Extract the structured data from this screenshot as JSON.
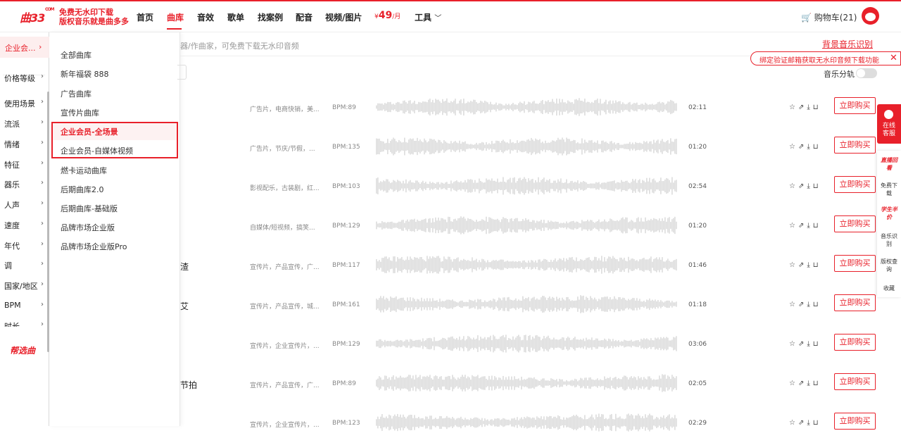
{
  "header": {
    "logo": "曲33",
    "logo_sup": "COM",
    "slogan_line1": "免费无水印下载",
    "slogan_line2": "版权音乐就是曲多多",
    "nav": [
      "首页",
      "曲库",
      "音效",
      "歌单",
      "找案例",
      "配音",
      "视频/图片"
    ],
    "active_nav": "曲库",
    "price_symbol": "¥",
    "price": "49",
    "price_unit": "/月",
    "tools": "工具",
    "cart": "购物车(21)"
  },
  "categories": {
    "first": "企业会...",
    "items": [
      "价格等级",
      "使用场景",
      "流派",
      "情绪",
      "特征",
      "器乐",
      "人声",
      "速度",
      "年代",
      "调",
      "国家/地区",
      "BPM",
      "时长"
    ],
    "help_select": "帮选曲"
  },
  "dropdown": {
    "items": [
      "全部曲库",
      "新年福袋 888",
      "广告曲库",
      "宣传片曲库",
      "企业会员-全场景",
      "企业会员-自媒体视频",
      "燃卡运动曲库",
      "后期曲库2.0",
      "后期曲库-基础版",
      "品牌市场企业版",
      "品牌市场企业版Pro"
    ],
    "active": "企业会员-全场景"
  },
  "toolbar": {
    "search_hint": "器/作曲家，可免费下载无水印音频",
    "bg_music_id": "背景音乐识别",
    "bind_tip": "绑定验证邮箱获取无水印音频下载功能",
    "bind_close": "✕",
    "split_label": "音乐分轨"
  },
  "tracks": [
    {
      "name": "",
      "tags": "广告片，电商快销，美...",
      "bpm": "BPM:89",
      "duration": "02:11",
      "buy": "立即购买"
    },
    {
      "name": "",
      "tags": "广告片，节庆/节假，...",
      "bpm": "BPM:135",
      "duration": "01:20",
      "buy": "立即购买"
    },
    {
      "name": "",
      "tags": "影视配乐，古装剧，红...",
      "bpm": "BPM:103",
      "duration": "02:54",
      "buy": "立即购买"
    },
    {
      "name": "",
      "tags": "自媒体/短视频，搞笑...",
      "bpm": "BPM:129",
      "duration": "01:20",
      "buy": "立即购买"
    },
    {
      "name": "渣",
      "tags": "宣传片，产品宣传，广...",
      "bpm": "BPM:117",
      "duration": "01:46",
      "buy": "立即购买"
    },
    {
      "name": "艾",
      "tags": "宣传片，产品宣传，城...",
      "bpm": "BPM:161",
      "duration": "01:18",
      "buy": "立即购买"
    },
    {
      "name": "",
      "tags": "宣传片，企业宣传片，...",
      "bpm": "BPM:129",
      "duration": "03:06",
      "buy": "立即购买"
    },
    {
      "name": "节拍",
      "tags": "宣传片，产品宣传，广...",
      "bpm": "BPM:89",
      "duration": "02:05",
      "buy": "立即购买"
    },
    {
      "name": "",
      "tags": "宣传片，企业宣传片，...",
      "bpm": "BPM:123",
      "duration": "02:29",
      "buy": "立即购买"
    }
  ],
  "row_icons": "☆⇗⤓⊔",
  "sidebar_right": {
    "service": "在线客服",
    "items": [
      "直播回看",
      "免费下载",
      "学生半价",
      "音乐识别",
      "版权查询",
      "收藏"
    ]
  },
  "colors": {
    "accent": "#e8202a",
    "wave": "#dcdcdc"
  }
}
